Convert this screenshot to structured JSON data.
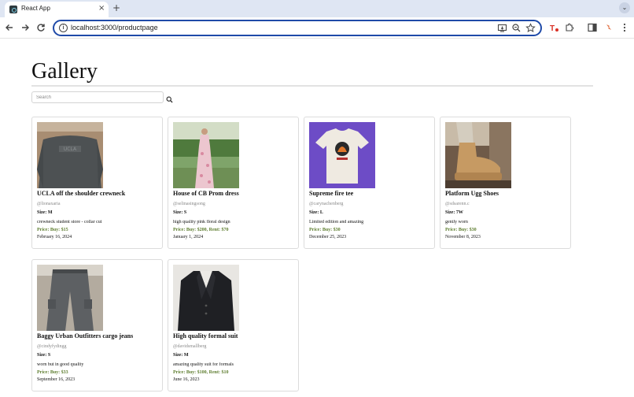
{
  "browser": {
    "tab_title": "React App",
    "tab_close": "×",
    "new_tab": "+",
    "menu_glyph": "⌄",
    "url": "localhost:3000/productpage",
    "site_info_glyph": "i",
    "icons": [
      "back-icon",
      "forward-icon",
      "reload-icon",
      "install-app-icon",
      "zoom-icon",
      "bookmark-star-icon",
      "extension-icon",
      "puzzle-icon",
      "side-panel-icon",
      "profile-extension-icon",
      "kebab-menu-icon"
    ]
  },
  "page": {
    "title": "Gallery",
    "search": {
      "placeholder": "Search",
      "value": ""
    }
  },
  "products": [
    {
      "name": "UCLA off the shoulder crewneck",
      "user": "@lionaxaria",
      "size_label": "Size: M",
      "description": "crewneck student store - collar cut",
      "price": "Price: Buy: $15",
      "date": "February 16, 2024",
      "image": "gray-crewneck"
    },
    {
      "name": "House of CB Prom dress",
      "user": "@selinasingsong",
      "size_label": "Size: S",
      "description": "high quality pink floral design",
      "price": "Price: Buy: $200, Rent: $70",
      "date": "January 1, 2024",
      "image": "pink-floral-dress"
    },
    {
      "name": "Supreme fire tee",
      "user": "@carynachenberg",
      "size_label": "Size: L",
      "description": "Limited edition and amazing",
      "price": "Price: Buy: $30",
      "date": "December 25, 2023",
      "image": "white-graphic-tee"
    },
    {
      "name": "Platform Ugg Shoes",
      "user": "@sdsarenn.c",
      "size_label": "Size: 7W",
      "description": "gently worn",
      "price": "Price: Buy: $30",
      "date": "November 8, 2023",
      "image": "tan-platform-ugg"
    },
    {
      "name": "Baggy Urban Outfitters cargo jeans",
      "user": "@cindyfydingg",
      "size_label": "Size: S",
      "description": "worn but in good quality",
      "price": "Price: Buy: $33",
      "date": "September 16, 2023",
      "image": "gray-cargo-jeans"
    },
    {
      "name": "High quality formal suit",
      "user": "@davidsmallberg",
      "size_label": "Size: M",
      "description": "amazing quality suit for formals",
      "price": "Price: Buy: $100, Rent: $10",
      "date": "June 16, 2023",
      "image": "black-suit-jacket"
    }
  ],
  "colors": {
    "price_green": "#5e7d2f",
    "omnibox_border": "#1f4aa8",
    "tab_strip": "#dfe6f3"
  }
}
